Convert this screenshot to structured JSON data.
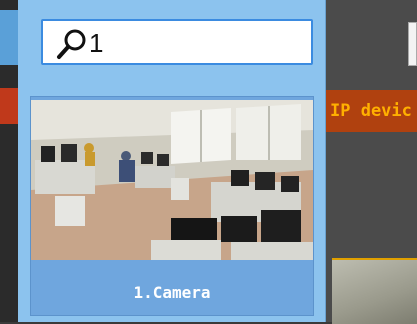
{
  "search": {
    "query": "1"
  },
  "results": [
    {
      "label": "1.Camera"
    }
  ],
  "background": {
    "device_header": "IP devic"
  },
  "colors": {
    "popup_bg": "#8cc3ee",
    "card_bg": "#6fa6de",
    "search_border": "#3b8be0",
    "header_bg": "#b0410f",
    "header_text": "#ffb000"
  },
  "icons": {
    "search": "search-icon"
  }
}
